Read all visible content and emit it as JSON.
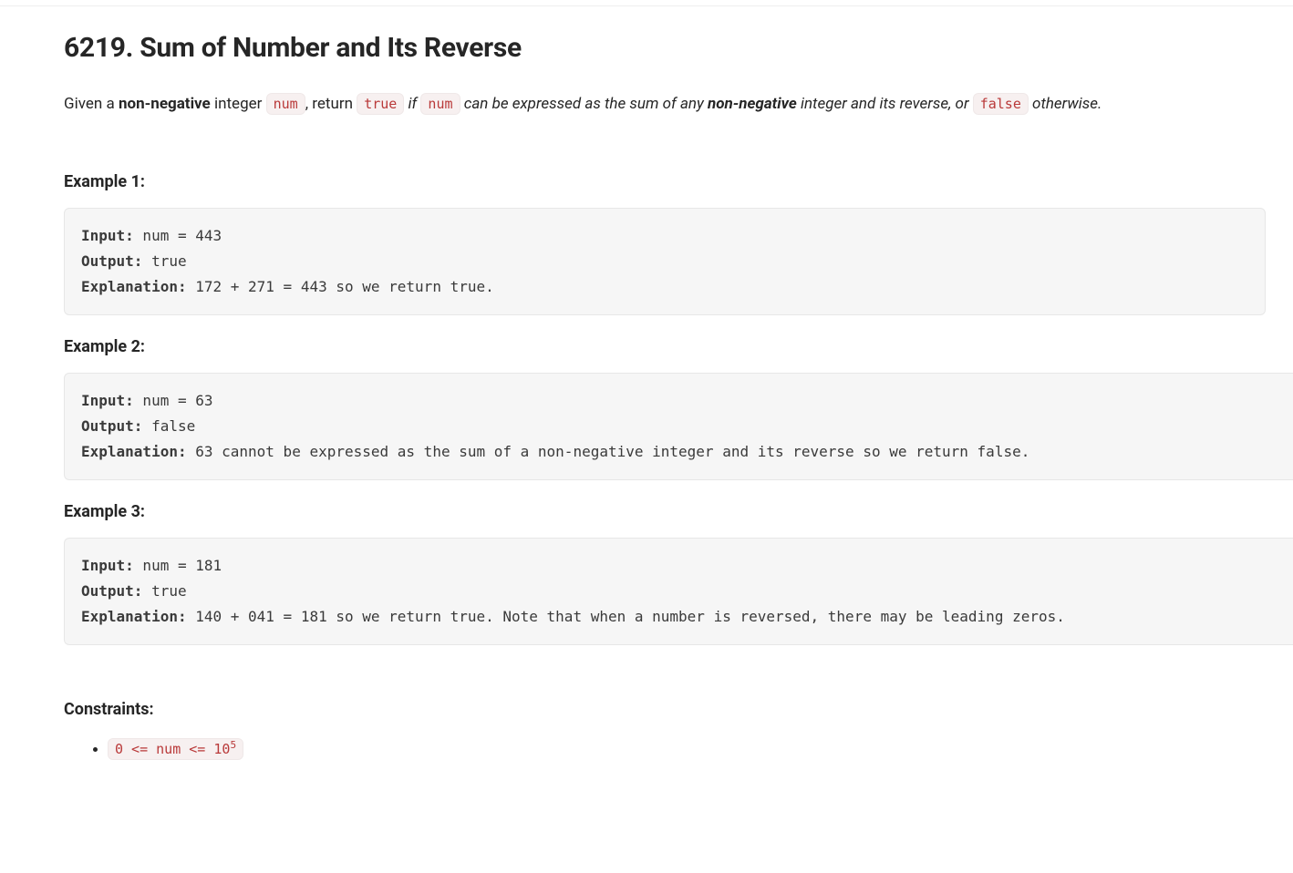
{
  "title": "6219. Sum of Number and Its Reverse",
  "description": {
    "pre1": "Given a ",
    "bold1": "non-negative",
    "mid1": " integer ",
    "code1": "num",
    "mid2": ", return ",
    "code2": "true",
    "ital1": " if ",
    "code3": "num",
    "ital2": " can be expressed as the sum of any ",
    "boldital": "non-negative",
    "ital3": " integer and its reverse, or ",
    "code4": "false",
    "ital4": " otherwise."
  },
  "labels": {
    "input": "Input:",
    "output": "Output:",
    "explanation": "Explanation:",
    "constraints": "Constraints:"
  },
  "examples": [
    {
      "heading": "Example 1:",
      "input": " num = 443",
      "output": " true",
      "explanation": " 172 + 271 = 443 so we return true."
    },
    {
      "heading": "Example 2:",
      "input": " num = 63",
      "output": " false",
      "explanation": " 63 cannot be expressed as the sum of a non-negative integer and its reverse so we return false."
    },
    {
      "heading": "Example 3:",
      "input": " num = 181",
      "output": " true",
      "explanation": " 140 + 041 = 181 so we return true. Note that when a number is reversed, there may be leading zeros."
    }
  ],
  "constraints": {
    "c1_pre": "0 <= num <= 10",
    "c1_sup": "5"
  }
}
